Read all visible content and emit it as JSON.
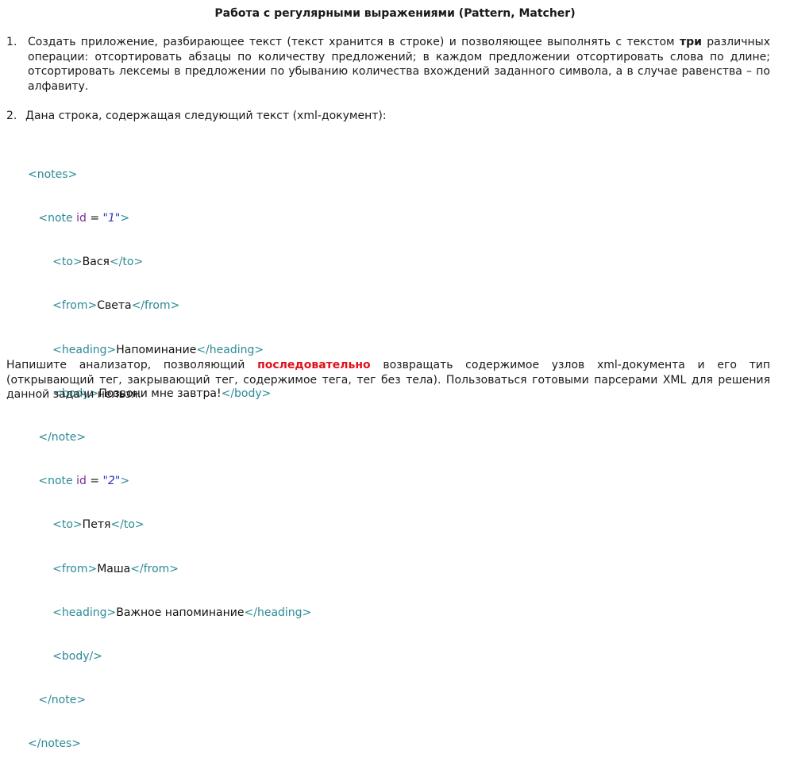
{
  "title": "Работа с регулярными выражениями (Pattern, Matcher)",
  "task1": {
    "number": "1.",
    "before": "Создать приложение, разбирающее текст (текст хранится в строке) и позволяющее выполнять с текстом ",
    "bold": "три",
    "after": " различных операции: отсортировать абзацы по количеству предложений; в каждом предложении отсортировать слова по длине; отсортировать лексемы в предложении по убыванию количества вхождений заданного символа, а в случае равенства – по алфавиту."
  },
  "task2": {
    "number": "2.",
    "text": "Дана строка, содержащая следующий текст (xml-документ):"
  },
  "xml": {
    "notes_open": "<notes>",
    "notes_close": "</notes>",
    "note_open_prefix": "<note ",
    "note_attr": "id",
    "note_eq": " = ",
    "note_close_bracket": ">",
    "note_close": "</note>",
    "notes": [
      {
        "id": "\"1\"",
        "to_open": "<to>",
        "to": "Вася",
        "to_close": "</to>",
        "from_open": "<from>",
        "from": "Света",
        "from_close": "</from>",
        "heading_open": "<heading>",
        "heading": "Напоминание",
        "heading_close": "</heading>",
        "body_open": "<body>",
        "body": "Позвони мне завтра!",
        "body_close": "</body>"
      },
      {
        "id": "\"2\"",
        "to_open": "<to>",
        "to": "Петя",
        "to_close": "</to>",
        "from_open": "<from>",
        "from": "Маша",
        "from_close": "</from>",
        "heading_open": "<heading>",
        "heading": "Важное напоминание",
        "heading_close": "</heading>",
        "body_empty": "<body/>"
      }
    ]
  },
  "bottom": {
    "before": "Напишите анализатор, позволяющий ",
    "highlight": "последовательно",
    "after": " возвращать содержимое узлов xml-документа и его тип (открывающий тег, закрывающий тег, содержимое тега, тег без тела). Пользоваться готовыми парсерами XML для решения данной задачи нельзя."
  },
  "colors": {
    "tag": "#2b8a96",
    "attr": "#7a2aa0",
    "value": "#2a30c8",
    "highlight": "#e0101a"
  }
}
